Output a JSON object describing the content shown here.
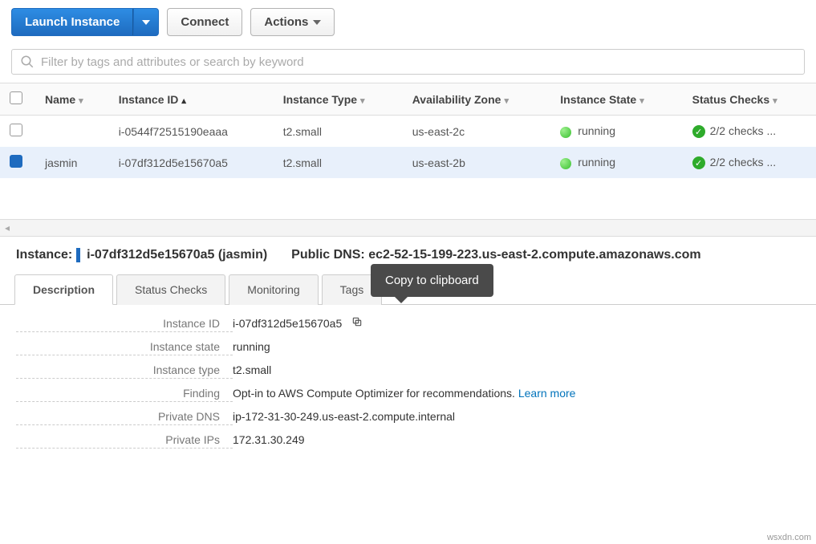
{
  "toolbar": {
    "launch_label": "Launch Instance",
    "connect_label": "Connect",
    "actions_label": "Actions"
  },
  "search": {
    "placeholder": "Filter by tags and attributes or search by keyword"
  },
  "columns": {
    "name": "Name",
    "instance_id": "Instance ID",
    "instance_type": "Instance Type",
    "az": "Availability Zone",
    "state": "Instance State",
    "status": "Status Checks"
  },
  "rows": [
    {
      "selected": false,
      "name": "",
      "instance_id": "i-0544f72515190eaaa",
      "instance_type": "t2.small",
      "az": "us-east-2c",
      "state": "running",
      "status": "2/2 checks ..."
    },
    {
      "selected": true,
      "name": "jasmin",
      "instance_id": "i-07df312d5e15670a5",
      "instance_type": "t2.small",
      "az": "us-east-2b",
      "state": "running",
      "status": "2/2 checks ..."
    }
  ],
  "detail_header": {
    "instance_label": "Instance:",
    "instance_value": "i-07df312d5e15670a5 (jasmin)",
    "dns_label": "Public DNS:",
    "dns_value": "ec2-52-15-199-223.us-east-2.compute.amazonaws.com"
  },
  "tabs": {
    "description": "Description",
    "status_checks": "Status Checks",
    "monitoring": "Monitoring",
    "tags": "Tags"
  },
  "tooltip": "Copy to clipboard",
  "detail": {
    "instance_id_label": "Instance ID",
    "instance_id": "i-07df312d5e15670a5",
    "state_label": "Instance state",
    "state": "running",
    "type_label": "Instance type",
    "type": "t2.small",
    "finding_label": "Finding",
    "finding_text": "Opt-in to AWS Compute Optimizer for recommendations. ",
    "finding_link": "Learn more",
    "private_dns_label": "Private DNS",
    "private_dns": "ip-172-31-30-249.us-east-2.compute.internal",
    "private_ips_label": "Private IPs",
    "private_ips": "172.31.30.249"
  },
  "watermark": "wsxdn.com"
}
